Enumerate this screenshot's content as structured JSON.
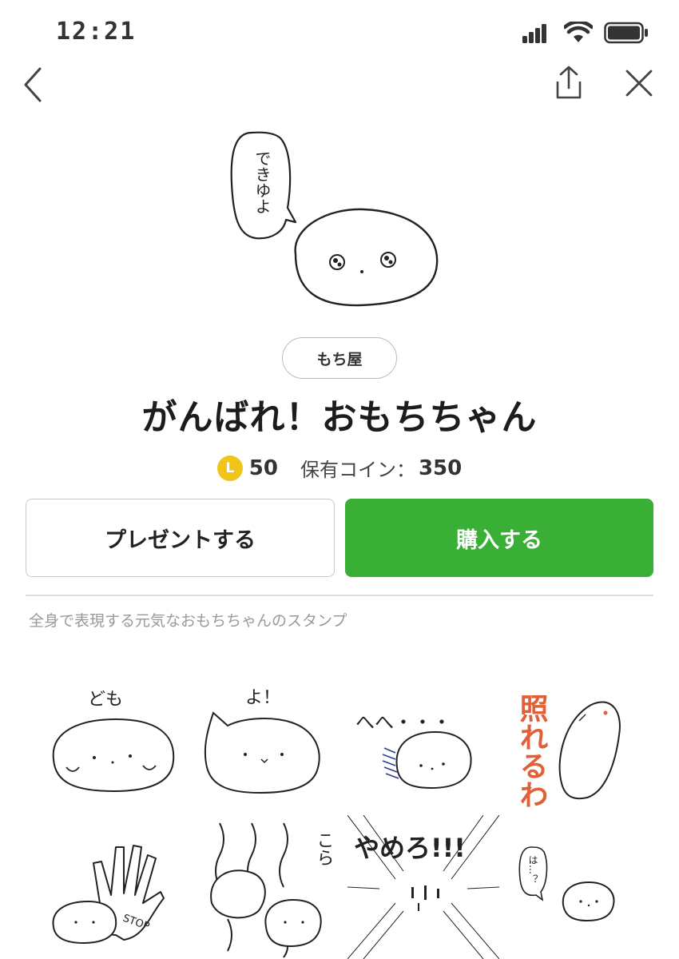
{
  "status_bar": {
    "time": "12:21"
  },
  "nav": {
    "back_icon": "chevron-left-icon",
    "share_icon": "share-icon",
    "close_icon": "close-icon"
  },
  "hero": {
    "speech_text": "できゆよ"
  },
  "author": "もち屋",
  "title": "がんばれ！おもちちゃん",
  "price": {
    "coin_symbol": "L",
    "value": "50",
    "owned_label": "保有コイン：",
    "owned_value": "350"
  },
  "buttons": {
    "gift": "プレゼントする",
    "buy": "購入する"
  },
  "description": "全身で表現する元気なおもちちゃんのスタンプ",
  "stickers": [
    {
      "text": "ども"
    },
    {
      "text": "よ！"
    },
    {
      "text": "へへ・・・"
    },
    {
      "text": "照れるわ"
    },
    {
      "text": "STOP"
    },
    {
      "text": "こら"
    },
    {
      "text": "やめろ!!!"
    },
    {
      "text": "は…？"
    }
  ],
  "colors": {
    "buy_green": "#3aaf35",
    "coin_yellow": "#f0c419",
    "blush_red": "#e0603a"
  }
}
